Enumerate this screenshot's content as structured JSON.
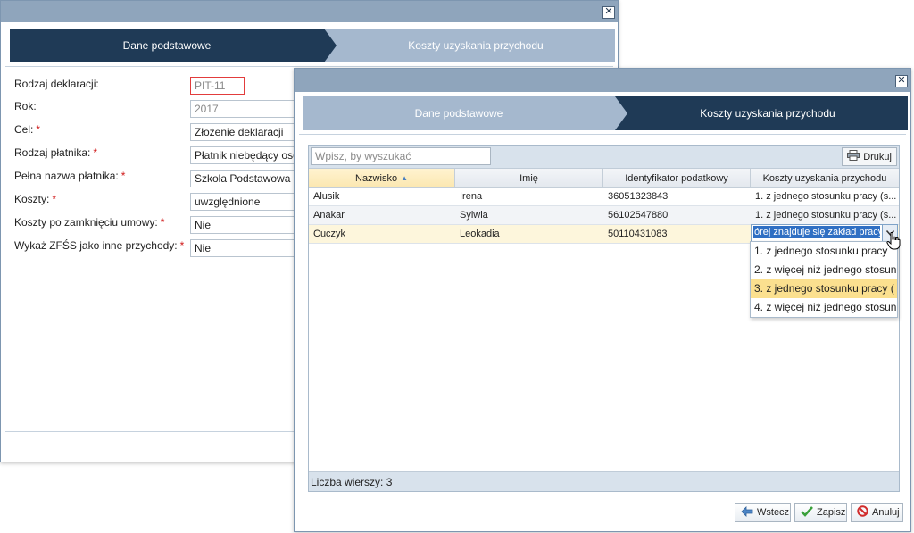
{
  "back_window": {
    "steps": [
      "Dane podstawowe",
      "Koszty uzyskania przychodu"
    ],
    "fields": [
      {
        "label": "Rodzaj deklaracji:",
        "required": false,
        "value": "PIT-11"
      },
      {
        "label": "Rok:",
        "required": false,
        "value": "2017"
      },
      {
        "label": "Cel:",
        "required": true,
        "value": "Złożenie deklaracji"
      },
      {
        "label": "Rodzaj płatnika:",
        "required": true,
        "value": "Płatnik niebędący osob"
      },
      {
        "label": "Pełna nazwa płatnika:",
        "required": true,
        "value": "Szkoła Podstawowa n"
      },
      {
        "label": "Koszty:",
        "required": true,
        "value": "uwzględnione"
      },
      {
        "label": "Koszty po zamknięciu umowy:",
        "required": true,
        "value": "Nie"
      },
      {
        "label": "Wykaż ZFŚS jako inne przychody:",
        "required": true,
        "value": "Nie"
      }
    ],
    "required_mark": "*"
  },
  "front_window": {
    "steps": [
      "Dane podstawowe",
      "Koszty uzyskania przychodu"
    ],
    "search": {
      "placeholder": "Wpisz, by wyszukać",
      "value": ""
    },
    "print_label": "Drukuj",
    "columns": [
      "Nazwisko",
      "Imię",
      "Identyfikator podatkowy",
      "Koszty uzyskania przychodu"
    ],
    "sort_indicator": "▲",
    "rows": [
      {
        "nazwisko": "Alusik",
        "imie": "Irena",
        "id": "36051323843",
        "koszty": "1. z jednego stosunku pracy (s..."
      },
      {
        "nazwisko": "Anakar",
        "imie": "Sylwia",
        "id": "56102547880",
        "koszty": "1. z jednego stosunku pracy (s..."
      },
      {
        "nazwisko": "Cuczyk",
        "imie": "Leokadia",
        "id": "50110431083",
        "koszty": ""
      }
    ],
    "editor_value": "órej znajduje się zakład pracy",
    "dropdown_options": [
      "1. z jednego stosunku pracy",
      "2. z więcej niż jednego stosun",
      "3. z jednego stosunku pracy (",
      "4. z więcej niż jednego stosun"
    ],
    "row_count_label": "Liczba wierszy: 3",
    "buttons": {
      "back": "Wstecz",
      "save": "Zapisz",
      "cancel": "Anuluj"
    }
  },
  "colors": {
    "step_active": "#1f3a56",
    "step_inactive": "#a5b8ce",
    "selected_row": "#fdf6dc",
    "highlight": "#fbe08f",
    "required": "#d01919"
  }
}
